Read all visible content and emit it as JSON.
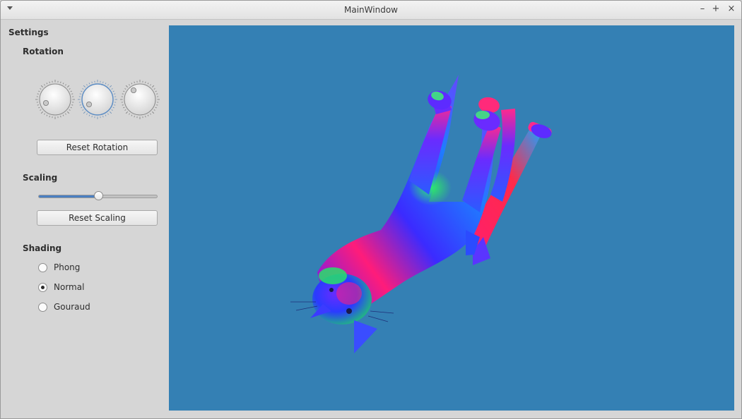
{
  "window": {
    "title": "MainWindow"
  },
  "sidebar": {
    "heading": "Settings",
    "rotation": {
      "heading": "Rotation",
      "reset_label": "Reset Rotation",
      "dials": [
        {
          "name": "x"
        },
        {
          "name": "y"
        },
        {
          "name": "z"
        }
      ]
    },
    "scaling": {
      "heading": "Scaling",
      "reset_label": "Reset Scaling",
      "slider_fraction": 0.5
    },
    "shading": {
      "heading": "Shading",
      "options": [
        {
          "label": "Phong",
          "selected": false
        },
        {
          "label": "Normal",
          "selected": true
        },
        {
          "label": "Gouraud",
          "selected": false
        }
      ]
    }
  },
  "viewport": {
    "background": "#3480b4",
    "model": "cat-mesh"
  },
  "colors": {
    "accent": "#4a7fc1"
  }
}
